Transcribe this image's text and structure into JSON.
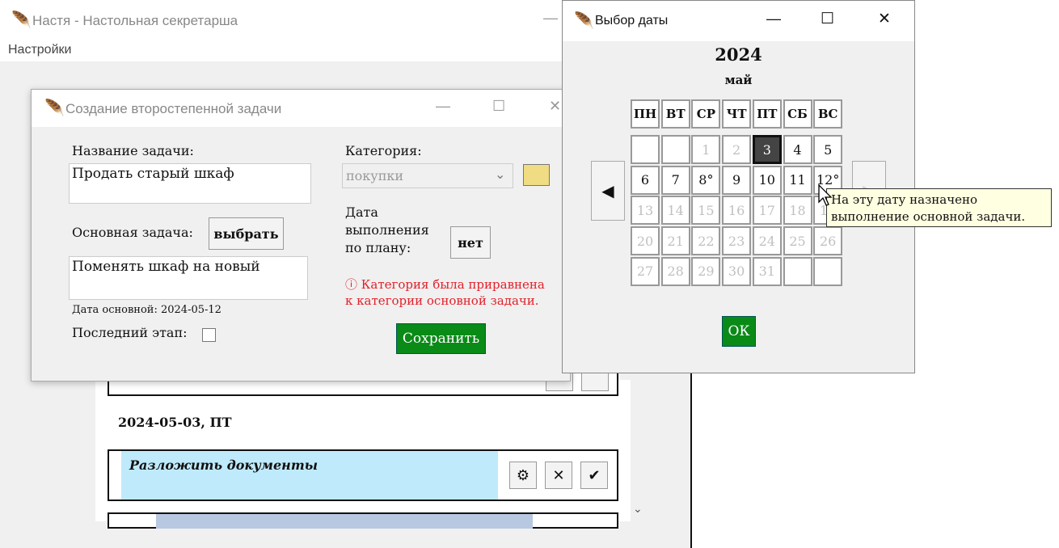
{
  "main": {
    "title": "Настя - Настольная секретарша",
    "menu": [
      "Настройки"
    ],
    "day_heading": "2024-05-03, ПТ",
    "task_label": "Разложить документы",
    "colors": {
      "task_bg": "#bfeafb",
      "task2_bg": "#b8c8e0"
    }
  },
  "dialog": {
    "title": "Создание второстепенной задачи",
    "name_label": "Название задачи:",
    "name_value": "Продать старый шкаф",
    "parent_label": "Основная задача:",
    "choose_button": "выбрать",
    "parent_value": "Поменять шкаф на новый",
    "parent_date": "Дата основной: 2024-05-12",
    "last_stage_label": "Последний этап:",
    "category_label": "Категория:",
    "category_value": "покупки",
    "category_color": "#f0dc82",
    "planned_date_label_1": "Дата",
    "planned_date_label_2": "выполнения",
    "planned_date_label_3": "по плану:",
    "planned_date_button": "нет",
    "warning_1": "ⓘ Категория была приравнена",
    "warning_2": "к категории основной задачи.",
    "save_button": "Сохранить"
  },
  "datepicker": {
    "title": "Выбор даты",
    "year": "2024",
    "month": "май",
    "weekdays": [
      "ПН",
      "ВТ",
      "СР",
      "ЧТ",
      "ПТ",
      "СБ",
      "ВС"
    ],
    "weeks": [
      [
        "",
        "",
        "1",
        "2",
        "3",
        "4",
        "5"
      ],
      [
        "6",
        "7",
        "8°",
        "9",
        "10",
        "11",
        "12°"
      ],
      [
        "13",
        "14",
        "15",
        "16",
        "17",
        "18",
        "19"
      ],
      [
        "20",
        "21",
        "22",
        "23",
        "24",
        "25",
        "26"
      ],
      [
        "27",
        "28",
        "29",
        "30",
        "31",
        "",
        ""
      ]
    ],
    "selected": "3",
    "ok_button": "ОК",
    "tooltip_1": "На эту дату назначено",
    "tooltip_2": "выполнение основной задачи."
  }
}
